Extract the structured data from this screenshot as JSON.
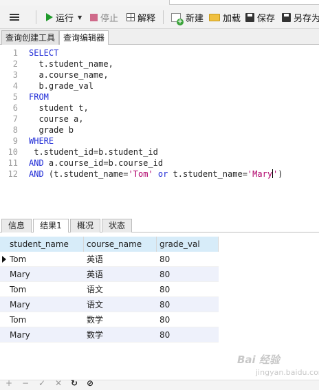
{
  "toolbar": {
    "run_label": "运行",
    "stop_label": "停止",
    "explain_label": "解释",
    "new_label": "新建",
    "load_label": "加载",
    "save_label": "保存",
    "save_as_label": "另存为"
  },
  "editor_tabs": [
    "查询创建工具",
    "查询编辑器"
  ],
  "editor": {
    "line_numbers": [
      "1",
      "2",
      "3",
      "4",
      "5",
      "6",
      "7",
      "8",
      "9",
      "10",
      "11",
      "12"
    ]
  },
  "result_tabs": [
    "信息",
    "结果1",
    "概况",
    "状态"
  ],
  "grid": {
    "columns": [
      "student_name",
      "course_name",
      "grade_val"
    ],
    "rows": [
      [
        "Tom",
        "英语",
        "80"
      ],
      [
        "Mary",
        "英语",
        "80"
      ],
      [
        "Tom",
        "语文",
        "80"
      ],
      [
        "Mary",
        "语文",
        "80"
      ],
      [
        "Tom",
        "数学",
        "80"
      ],
      [
        "Mary",
        "数学",
        "80"
      ]
    ]
  },
  "bottom_bar": {
    "add": "+",
    "remove": "−",
    "apply": "✓",
    "discard": "✕",
    "refresh": "↻",
    "stop": "⊘"
  }
}
